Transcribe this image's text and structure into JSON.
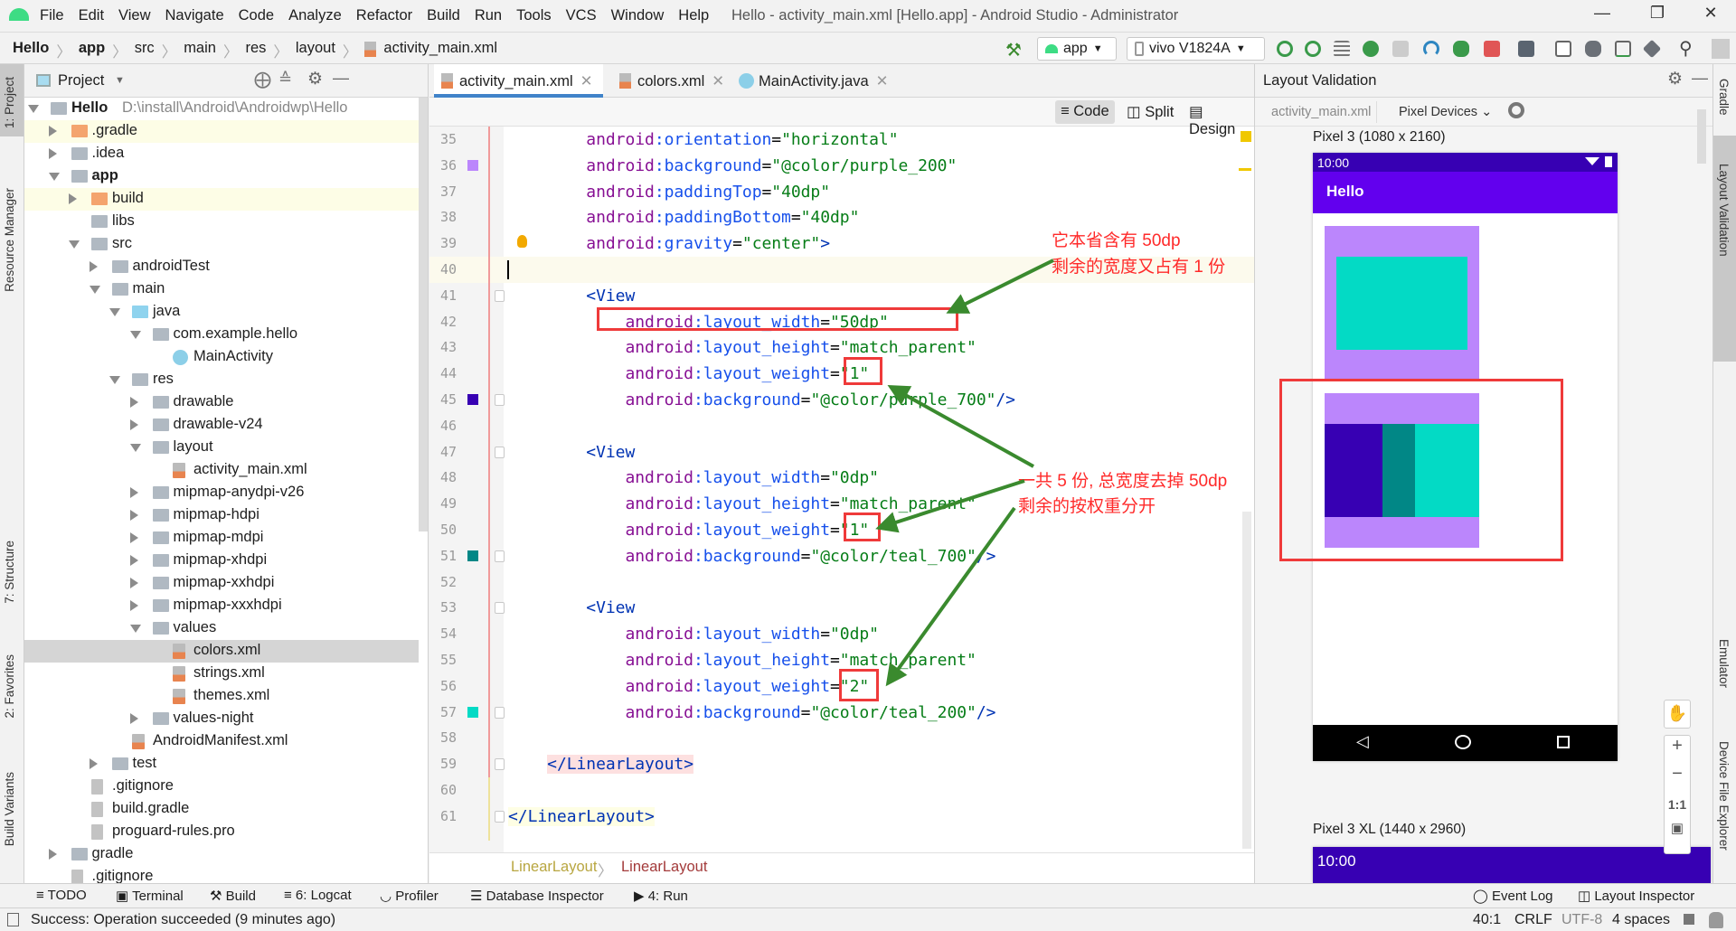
{
  "window": {
    "title": "Hello - activity_main.xml [Hello.app] - Android Studio - Administrator",
    "menu": [
      "File",
      "Edit",
      "View",
      "Navigate",
      "Code",
      "Analyze",
      "Refactor",
      "Build",
      "Run",
      "Tools",
      "VCS",
      "Window",
      "Help"
    ]
  },
  "navbar": {
    "crumbs": [
      "Hello",
      "app",
      "src",
      "main",
      "res",
      "layout",
      "activity_main.xml"
    ],
    "run_config": "app",
    "device": "vivo V1824A"
  },
  "left_stripe": [
    "1: Project",
    "Resource Manager",
    "7: Structure",
    "2: Favorites",
    "Build Variants"
  ],
  "project": {
    "title": "Project",
    "tree": [
      {
        "label": "Hello",
        "path": "D:\\install\\Android\\Androidwp\\Hello",
        "level": 0,
        "state": "e",
        "icon": "module",
        "bold": true
      },
      {
        "label": ".gradle",
        "level": 1,
        "state": "c",
        "icon": "orange",
        "hl": true
      },
      {
        "label": ".idea",
        "level": 1,
        "state": "c",
        "icon": "folder"
      },
      {
        "label": "app",
        "level": 1,
        "state": "e",
        "icon": "module",
        "bold": true
      },
      {
        "label": "build",
        "level": 2,
        "state": "c",
        "icon": "orange",
        "hl": true
      },
      {
        "label": "libs",
        "level": 2,
        "state": "",
        "icon": "folder"
      },
      {
        "label": "src",
        "level": 2,
        "state": "e",
        "icon": "folder"
      },
      {
        "label": "androidTest",
        "level": 3,
        "state": "c",
        "icon": "folder"
      },
      {
        "label": "main",
        "level": 3,
        "state": "e",
        "icon": "folder"
      },
      {
        "label": "java",
        "level": 4,
        "state": "e",
        "icon": "blue"
      },
      {
        "label": "com.example.hello",
        "level": 5,
        "state": "e",
        "icon": "folder"
      },
      {
        "label": "MainActivity",
        "level": 6,
        "state": "",
        "icon": "cls"
      },
      {
        "label": "res",
        "level": 4,
        "state": "e",
        "icon": "folder"
      },
      {
        "label": "drawable",
        "level": 5,
        "state": "c",
        "icon": "folder"
      },
      {
        "label": "drawable-v24",
        "level": 5,
        "state": "c",
        "icon": "folder"
      },
      {
        "label": "layout",
        "level": 5,
        "state": "e",
        "icon": "folder"
      },
      {
        "label": "activity_main.xml",
        "level": 6,
        "state": "",
        "icon": "xml"
      },
      {
        "label": "mipmap-anydpi-v26",
        "level": 5,
        "state": "c",
        "icon": "folder"
      },
      {
        "label": "mipmap-hdpi",
        "level": 5,
        "state": "c",
        "icon": "folder"
      },
      {
        "label": "mipmap-mdpi",
        "level": 5,
        "state": "c",
        "icon": "folder"
      },
      {
        "label": "mipmap-xhdpi",
        "level": 5,
        "state": "c",
        "icon": "folder"
      },
      {
        "label": "mipmap-xxhdpi",
        "level": 5,
        "state": "c",
        "icon": "folder"
      },
      {
        "label": "mipmap-xxxhdpi",
        "level": 5,
        "state": "c",
        "icon": "folder"
      },
      {
        "label": "values",
        "level": 5,
        "state": "e",
        "icon": "folder"
      },
      {
        "label": "colors.xml",
        "level": 6,
        "state": "",
        "icon": "xml",
        "selected": true
      },
      {
        "label": "strings.xml",
        "level": 6,
        "state": "",
        "icon": "xml"
      },
      {
        "label": "themes.xml",
        "level": 6,
        "state": "",
        "icon": "xml"
      },
      {
        "label": "values-night",
        "level": 5,
        "state": "c",
        "icon": "folder"
      },
      {
        "label": "AndroidManifest.xml",
        "level": 4,
        "state": "",
        "icon": "xml"
      },
      {
        "label": "test",
        "level": 3,
        "state": "c",
        "icon": "folder"
      },
      {
        "label": ".gitignore",
        "level": 2,
        "state": "",
        "icon": "file"
      },
      {
        "label": "build.gradle",
        "level": 2,
        "state": "",
        "icon": "file"
      },
      {
        "label": "proguard-rules.pro",
        "level": 2,
        "state": "",
        "icon": "file"
      },
      {
        "label": "gradle",
        "level": 1,
        "state": "c",
        "icon": "folder"
      },
      {
        "label": ".gitignore",
        "level": 1,
        "state": "",
        "icon": "file"
      }
    ]
  },
  "editor": {
    "tabs": [
      {
        "label": "activity_main.xml",
        "active": true
      },
      {
        "label": "colors.xml"
      },
      {
        "label": "MainActivity.java"
      }
    ],
    "modes": [
      "Code",
      "Split",
      "Design"
    ],
    "lines": [
      {
        "n": "35",
        "text": "        android:orientation=\"horizontal\""
      },
      {
        "n": "36",
        "text": "        android:background=\"@color/purple_200\"",
        "swatch": "#BB86FC"
      },
      {
        "n": "37",
        "text": "        android:paddingTop=\"40dp\""
      },
      {
        "n": "38",
        "text": "        android:paddingBottom=\"40dp\""
      },
      {
        "n": "39",
        "text": "        android:gravity=\"center\">",
        "bulb": true
      },
      {
        "n": "40",
        "text": "",
        "current": true
      },
      {
        "n": "41",
        "text": "        <View",
        "fold": true
      },
      {
        "n": "42",
        "text": "            android:layout_width=\"50dp\""
      },
      {
        "n": "43",
        "text": "            android:layout_height=\"match_parent\""
      },
      {
        "n": "44",
        "text": "            android:layout_weight=\"1\""
      },
      {
        "n": "45",
        "text": "            android:background=\"@color/purple_700\"/>",
        "swatch": "#3700B3",
        "fold": true
      },
      {
        "n": "46",
        "text": ""
      },
      {
        "n": "47",
        "text": "        <View",
        "fold": true
      },
      {
        "n": "48",
        "text": "            android:layout_width=\"0dp\""
      },
      {
        "n": "49",
        "text": "            android:layout_height=\"match_parent\""
      },
      {
        "n": "50",
        "text": "            android:layout_weight=\"1\""
      },
      {
        "n": "51",
        "text": "            android:background=\"@color/teal_700\"/>",
        "swatch": "#018786",
        "fold": true
      },
      {
        "n": "52",
        "text": ""
      },
      {
        "n": "53",
        "text": "        <View",
        "fold": true
      },
      {
        "n": "54",
        "text": "            android:layout_width=\"0dp\""
      },
      {
        "n": "55",
        "text": "            android:layout_height=\"match_parent\""
      },
      {
        "n": "56",
        "text": "            android:layout_weight=\"2\""
      },
      {
        "n": "57",
        "text": "            android:background=\"@color/teal_200\"/>",
        "swatch": "#03DAC5",
        "fold": true
      },
      {
        "n": "58",
        "text": ""
      },
      {
        "n": "59",
        "text": "    </LinearLayout>",
        "fold": true,
        "bg": "pink"
      },
      {
        "n": "60",
        "text": ""
      },
      {
        "n": "61",
        "text": "</LinearLayout>",
        "fold": true,
        "bg": "yellow"
      }
    ],
    "breadcrumb": [
      "LinearLayout",
      "LinearLayout"
    ]
  },
  "annotations": {
    "note1": [
      "它本省含有 50dp",
      "剩余的宽度又占有 1 份"
    ],
    "note2": [
      "一共 5 份, 总宽度去掉 50dp",
      "剩余的按权重分开"
    ]
  },
  "validation": {
    "title": "Layout Validation",
    "file": "activity_main.xml",
    "devices": "Pixel Devices",
    "device1": "Pixel 3 (1080 x 2160)",
    "device2": "Pixel 3 XL (1440 x 2960)",
    "time": "10:00",
    "app_title": "Hello",
    "zoom_reset": "1:1",
    "weights": [
      1,
      1,
      2
    ],
    "fixed_width_dp": 50
  },
  "right_stripe": [
    "Gradle",
    "Layout Validation",
    "Emulator",
    "Device File Explorer"
  ],
  "toolwindows": [
    "TODO",
    "Terminal",
    "Build",
    "6: Logcat",
    "Profiler",
    "Database Inspector",
    "4: Run"
  ],
  "right_toolwindows": [
    "Event Log",
    "Layout Inspector"
  ],
  "status": {
    "message": "Success: Operation succeeded (9 minutes ago)",
    "position": "40:1",
    "line_sep": "CRLF",
    "encoding": "UTF-8",
    "indent": "4 spaces"
  },
  "colors": {
    "purple_200": "#BB86FC",
    "purple_500": "#6200EE",
    "purple_700": "#3700B3",
    "teal_200": "#03DAC5",
    "teal_700": "#018786",
    "annotation": "#FF2A2A",
    "arrow": "#3A8A2E",
    "accent": "#4083C9"
  }
}
